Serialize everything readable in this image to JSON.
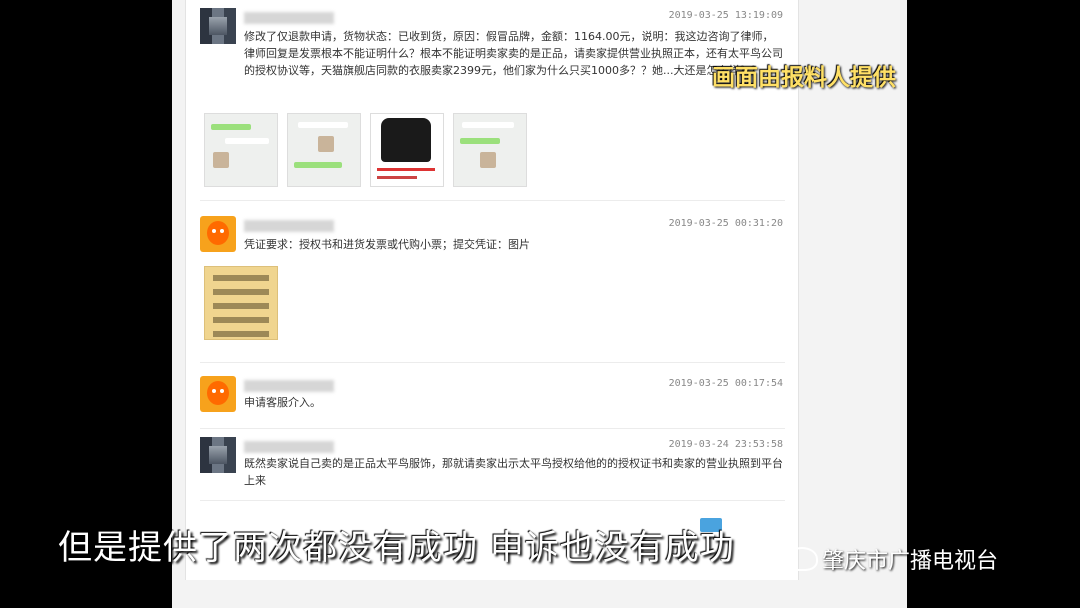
{
  "messages": [
    {
      "time": "2019-03-25 13:19:09",
      "text": "修改了仅退款申请，货物状态：已收到货，原因：假冒品牌，金额：1164.00元，说明：我这边咨询了律师，律师回复是发票根本不能证明什么？根本不能证明卖家卖的是正品，请卖家提供营业执照正本，还有太平鸟公司的授权协议等，天猫旗舰店同款的衣服卖家2399元，他们家为什么只买1000多？？她...大还是怎么样？？。",
      "thumbnails": [
        "chat-screenshot-1",
        "chat-screenshot-2",
        "leather-jacket-listing",
        "chat-screenshot-3"
      ]
    },
    {
      "time": "2019-03-25 00:31:20",
      "text": "凭证要求：授权书和进货发票或代购小票；提交凭证：图片"
    },
    {
      "time": "2019-03-25 00:17:54",
      "text": "申请客服介入。"
    },
    {
      "time": "2019-03-24 23:53:58",
      "text": "既然卖家说自己卖的是正品太平鸟服饰，那就请卖家出示太平鸟授权给他的的授权证书和卖家的营业执照到平台上来"
    }
  ],
  "overlay": {
    "source_note": "画面由报料人提供",
    "subtitle": "但是提供了两次都没有成功  申诉也没有成功",
    "channel_logo": "肇庆市广播电视台"
  },
  "colors": {
    "overlay_source": "#ffe066",
    "background": "#000000",
    "avatar_orange": "#f7a21c"
  }
}
